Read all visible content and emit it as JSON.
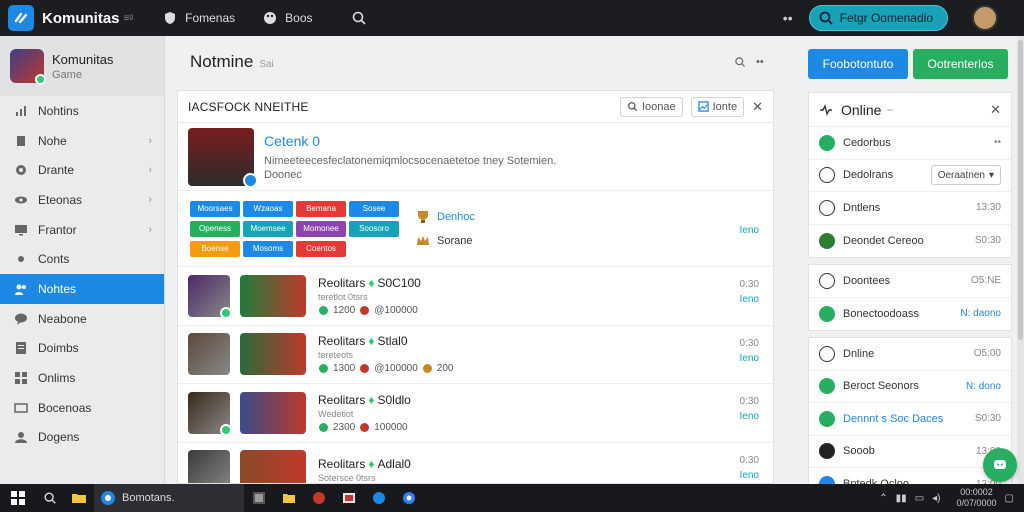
{
  "app": {
    "title": "Komunitas",
    "title_suffix": "≡ᶢ",
    "nav": [
      {
        "label": "Fomenas",
        "icon": "shield-icon"
      },
      {
        "label": "Boos",
        "icon": "palette-icon"
      }
    ],
    "top_dots": "••",
    "cta_label": "Fetgr Oomenadio"
  },
  "sidebar": {
    "header_title": "Komunitas",
    "header_sub": "Game",
    "items": [
      {
        "label": "Nohtins",
        "icon": "chart-icon",
        "chevron": false,
        "active": false
      },
      {
        "label": "Nohe",
        "icon": "file-icon",
        "chevron": true,
        "active": false
      },
      {
        "label": "Drante",
        "icon": "gear-icon",
        "chevron": true,
        "active": false
      },
      {
        "label": "Eteonas",
        "icon": "eye-icon",
        "chevron": true,
        "active": false
      },
      {
        "label": "Frantor",
        "icon": "monitor-icon",
        "chevron": true,
        "active": false
      },
      {
        "label": "Conts",
        "icon": "dot-icon",
        "chevron": false,
        "active": false
      },
      {
        "label": "Nohtes",
        "icon": "users-icon",
        "chevron": false,
        "active": true
      },
      {
        "label": "Neabone",
        "icon": "chat-icon",
        "chevron": false,
        "active": false
      },
      {
        "label": "Doimbs",
        "icon": "document-icon",
        "chevron": false,
        "active": false
      },
      {
        "label": "Onlims",
        "icon": "grid-icon",
        "chevron": false,
        "active": false
      },
      {
        "label": "Bocenoas",
        "icon": "window-icon",
        "chevron": false,
        "active": false
      },
      {
        "label": "Dogens",
        "icon": "user-icon",
        "chevron": false,
        "active": false
      }
    ]
  },
  "main": {
    "title": "Notmine",
    "title_sub": "Sai",
    "tools_dots": "••",
    "panel_title": "IACSFOCK NNEITHE",
    "search_chip": "Ioonae",
    "filter_chip": "Ionte",
    "feature": {
      "name": "Cetenk 0",
      "desc": "Nimeeteecesfeclatonemiqmlocsocenaetetoe tney Sotemien.",
      "sub": "Doonec"
    },
    "tags": [
      {
        "label": "Moorsaes",
        "color": "#1e88e5"
      },
      {
        "label": "Wzaoas",
        "color": "#1e88e5"
      },
      {
        "label": "Bemana",
        "color": "#e53935"
      },
      {
        "label": "Sosee",
        "color": "#1e88e5"
      },
      {
        "label": "Openess",
        "color": "#27ae60"
      },
      {
        "label": "Moemsee",
        "color": "#17a2b8"
      },
      {
        "label": "Momonee",
        "color": "#8e44ad"
      },
      {
        "label": "Soosoro",
        "color": "#17a2b8"
      },
      {
        "label": "Boense",
        "color": "#f39c12"
      },
      {
        "label": "Mosoms",
        "color": "#1e88e5"
      },
      {
        "label": "Coentos",
        "color": "#e53935"
      }
    ],
    "tag_side": [
      {
        "label": "Denhoc",
        "icon": "trophy-icon",
        "blue": true
      },
      {
        "label": "Sorane",
        "icon": "crown-icon",
        "blue": false
      }
    ],
    "tags_meta": "Ieno",
    "rows": [
      {
        "title": "Reolitars",
        "title_right": "S0C100",
        "sub": "teretlot 0tsrs",
        "stats": [
          "1200",
          "@100000"
        ],
        "time": "0:30",
        "link": "Ieno"
      },
      {
        "title": "Reolitars",
        "title_right": "Stlal0",
        "sub": "tereteots",
        "stats": [
          "1300",
          "@100000",
          "200"
        ],
        "time": "0:30",
        "link": "Ieno"
      },
      {
        "title": "Reolitars",
        "title_right": "S0ldlo",
        "sub": "Wedetiot",
        "stats": [
          "2300",
          "100000"
        ],
        "time": "0:30",
        "link": "Ieno"
      },
      {
        "title": "Reolitars",
        "title_right": "Adlal0",
        "sub": "Sotersce 0tsrs",
        "stats": [],
        "time": "0:30",
        "link": "Ieno"
      }
    ]
  },
  "right": {
    "primary_btn": "Foobotontuto",
    "secondary_btn": "Ootrenterlos",
    "online_box": {
      "title": "Online",
      "dash": "−",
      "rows": [
        {
          "label": "Cedorbus",
          "value": "••",
          "icon_color": "#27ae60"
        },
        {
          "label": "Dedolrans",
          "select": "Oeraatnen",
          "icon_color": "#ffffff"
        },
        {
          "label": "Dntlens",
          "value": "13:30",
          "icon_color": "#ffffff"
        },
        {
          "label": "Deondet Cereoo",
          "value": "S0:30",
          "icon_color": "#2e7d32"
        }
      ]
    },
    "box2": {
      "rows": [
        {
          "label": "Doontees",
          "value": "O5:NE",
          "icon_color": "#ffffff"
        },
        {
          "label": "Bonectoodoass",
          "value": "N: daono",
          "blue": true,
          "icon_color": "#27ae60"
        }
      ]
    },
    "box3": {
      "rows": [
        {
          "label": "Dnline",
          "value": "O5:00",
          "icon_color": "#ffffff"
        },
        {
          "label": "Beroct Seonors",
          "value": "N: dono",
          "blue": true,
          "icon_color": "#27ae60"
        },
        {
          "label": "Dennnt s Soc Daces",
          "value": "S0:30",
          "label_blue": true,
          "icon_color": "#27ae60"
        },
        {
          "label": "Sooob",
          "value": "13:00",
          "icon_color": "#222222"
        },
        {
          "label": "Bntedk Ocloo",
          "value": "13:00",
          "icon_color": "#1e88e5"
        }
      ]
    }
  },
  "taskbar": {
    "active_label": "Bomotans.",
    "clock_time": "00:0002",
    "clock_date": "0/07/0000"
  },
  "colors": {
    "accent": "#1e88e5",
    "success": "#27ae60",
    "teal": "#17a2b8",
    "topbar": "#1b1d21"
  }
}
